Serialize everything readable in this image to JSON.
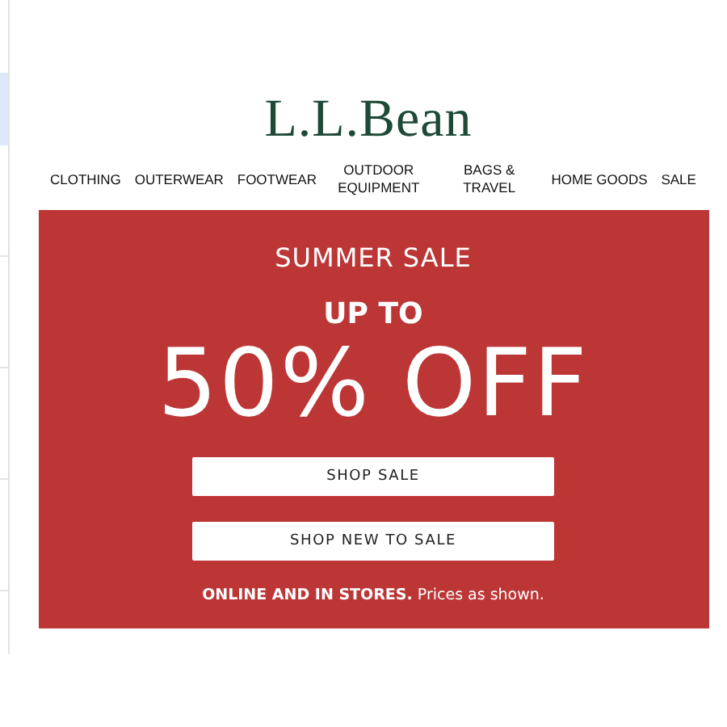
{
  "logo": "L.L.Bean",
  "nav": [
    {
      "label": "CLOTHING"
    },
    {
      "label": "OUTERWEAR"
    },
    {
      "label": "FOOTWEAR"
    },
    {
      "label": "OUTDOOR EQUIPMENT"
    },
    {
      "label": "BAGS & TRAVEL"
    },
    {
      "label": "HOME GOODS"
    },
    {
      "label": "SALE"
    }
  ],
  "banner": {
    "title": "SUMMER SALE",
    "kicker": "UP TO",
    "headline": "50% OFF",
    "buttons": [
      "SHOP SALE",
      "SHOP NEW TO SALE"
    ],
    "note": "**ONLINE AND IN STORES.** Prices as shown."
  }
}
